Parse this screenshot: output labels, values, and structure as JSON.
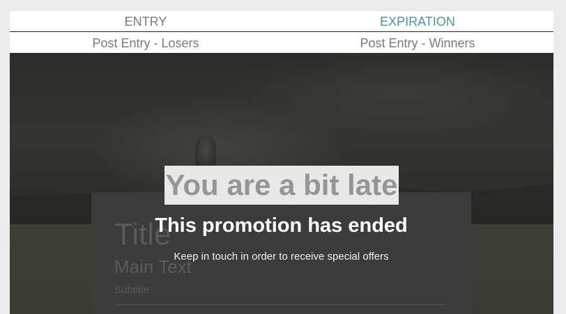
{
  "tabs": {
    "row1": [
      {
        "label": "ENTRY",
        "active": false
      },
      {
        "label": "EXPIRATION",
        "active": true
      }
    ],
    "row2": [
      {
        "label": "Post Entry - Losers"
      },
      {
        "label": "Post Entry - Winners"
      }
    ]
  },
  "card": {
    "title": "Title",
    "main_text": "Main Text",
    "subtitle": "Subtitle"
  },
  "overlay": {
    "late_heading": "You are a bit late",
    "ended_heading": "This promotion has ended",
    "keep_in_touch": "Keep in touch in order to receive special offers"
  },
  "colors": {
    "active_tab": "#4a93a8",
    "inactive_tab": "#7a7a7a"
  }
}
